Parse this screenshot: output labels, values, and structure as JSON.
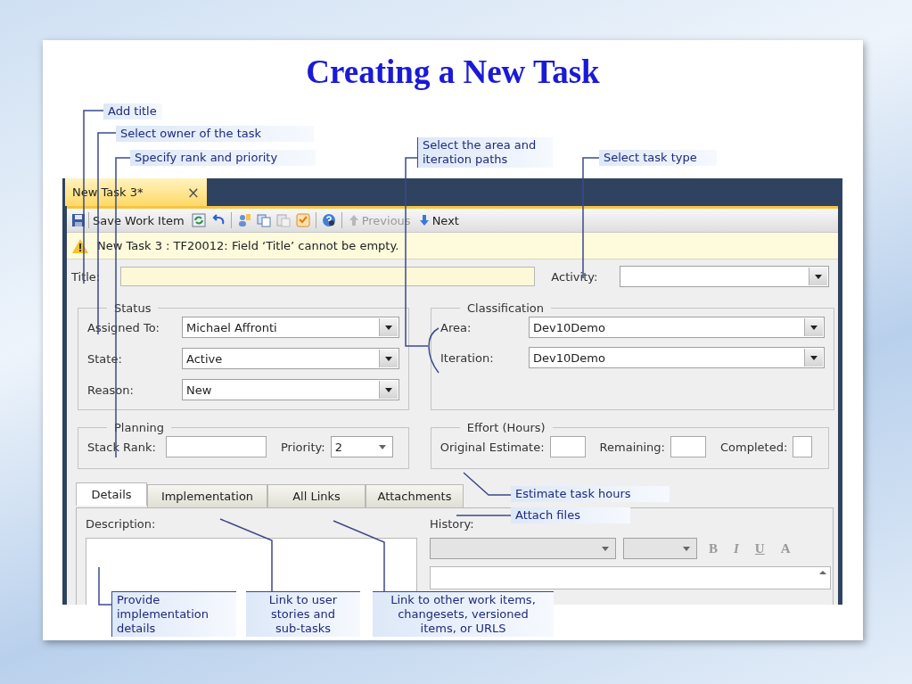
{
  "slide_title": "Creating a New Task",
  "document_tab": {
    "label": "New Task 3*",
    "close": "×",
    "selected": true
  },
  "toolbar": {
    "save": "Save Work Item",
    "previous": {
      "label": "Previous",
      "disabled": true
    },
    "next": {
      "label": "Next",
      "disabled": false
    }
  },
  "warning": "New Task 3 : TF20012: Field ‘Title’ cannot be empty.",
  "title_field": {
    "label": "Title:"
  },
  "activity": {
    "label": "Activity:"
  },
  "status": {
    "title": "Status",
    "fields": [
      {
        "label": "Assigned To:",
        "value": "Michael Affronti"
      },
      {
        "label": "State:",
        "value": "Active"
      },
      {
        "label": "Reason:",
        "value": "New"
      }
    ]
  },
  "classification": {
    "title": "Classification",
    "fields": [
      {
        "label": "Area:",
        "value": "Dev10Demo"
      },
      {
        "label": "Iteration:",
        "value": "Dev10Demo"
      }
    ]
  },
  "planning": {
    "title": "Planning",
    "stack_rank": {
      "label": "Stack Rank:"
    },
    "priority": {
      "label": "Priority:",
      "value": "2"
    }
  },
  "effort": {
    "title": "Effort (Hours)",
    "fields": [
      {
        "label": "Original Estimate:"
      },
      {
        "label": "Remaining:"
      },
      {
        "label": "Completed:"
      }
    ]
  },
  "tabs": [
    {
      "label": "Details",
      "selected": true
    },
    {
      "label": "Implementation",
      "selected": false
    },
    {
      "label": "All Links",
      "selected": false
    },
    {
      "label": "Attachments",
      "selected": false
    }
  ],
  "description": {
    "label": "Description:"
  },
  "history": {
    "label": "History:",
    "format_buttons": [
      {
        "label": "B",
        "disabled": true
      },
      {
        "label": "I",
        "disabled": true
      },
      {
        "label": "U",
        "disabled": true
      },
      {
        "label": "A",
        "disabled": true
      }
    ]
  },
  "callouts": [
    {
      "lines": [
        "Add title"
      ]
    },
    {
      "lines": [
        "Select owner of the task"
      ]
    },
    {
      "lines": [
        "Specify rank and priority"
      ]
    },
    {
      "lines": [
        "Select the area and",
        "iteration paths"
      ]
    },
    {
      "lines": [
        "Select task type"
      ]
    },
    {
      "lines": [
        "Estimate task hours"
      ]
    },
    {
      "lines": [
        "Attach files"
      ]
    },
    {
      "lines": [
        "Provide",
        "implementation",
        "details"
      ]
    },
    {
      "lines": [
        "Link to user",
        "stories and",
        "sub-tasks"
      ]
    },
    {
      "lines": [
        "Link to other work items,",
        "changesets, versioned",
        "items, or URLS"
      ]
    }
  ]
}
